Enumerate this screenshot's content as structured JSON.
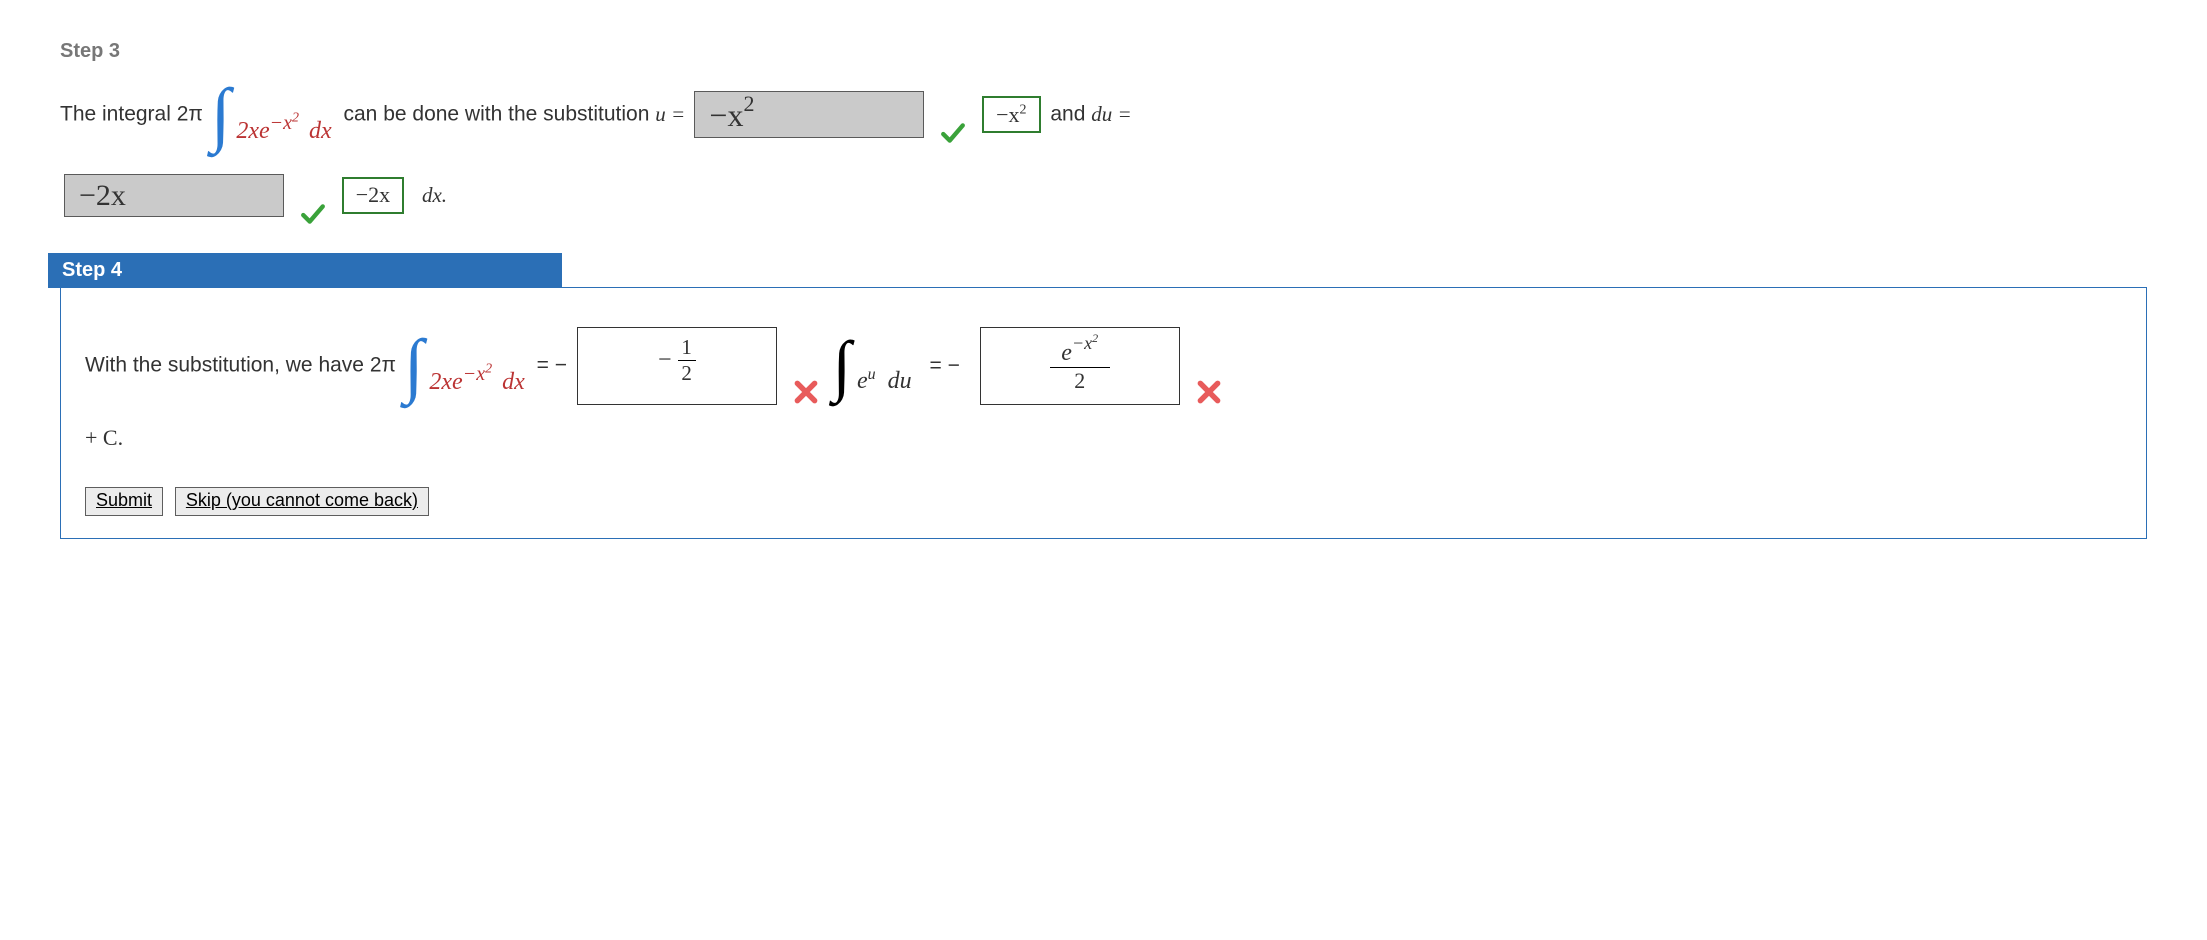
{
  "step3": {
    "title": "Step 3",
    "text1": "The integral  2π ",
    "integral_inside": "2xe",
    "integral_exp": "−x",
    "integral_exp_sup": "2",
    "dx": "dx",
    "text2": " can be done with the substitution ",
    "u_eq": "u = ",
    "box_u_user": "−x",
    "box_u_user_sup": "2",
    "correct_u_top_sup": "2",
    "correct_u": "−x",
    "and_du": " and ",
    "du_eq": "du = ",
    "box_du_user": "−2x",
    "correct_du": "−2x",
    "trailing_dx_dot": "dx."
  },
  "step4": {
    "title": "Step 4",
    "text1": "With the substitution, we have  2π ",
    "integral_inside": "2xe",
    "integral_exp": "−x",
    "integral_exp_sup": "2",
    "dx": "dx",
    "eq_neg": " = −",
    "box1_top": "1",
    "box1_neg": "−",
    "box1_bot": "2",
    "middle_int_label": "e",
    "middle_int_sup": "u",
    "middle_du": "du",
    "eq_neg2": "= −",
    "box2_top_e": "e",
    "box2_top_exp": "−x",
    "box2_top_exp_sup": "2",
    "box2_bot": "2",
    "plus_c": "+ C."
  },
  "buttons": {
    "submit": "Submit",
    "skip": "Skip (you cannot come back)"
  }
}
